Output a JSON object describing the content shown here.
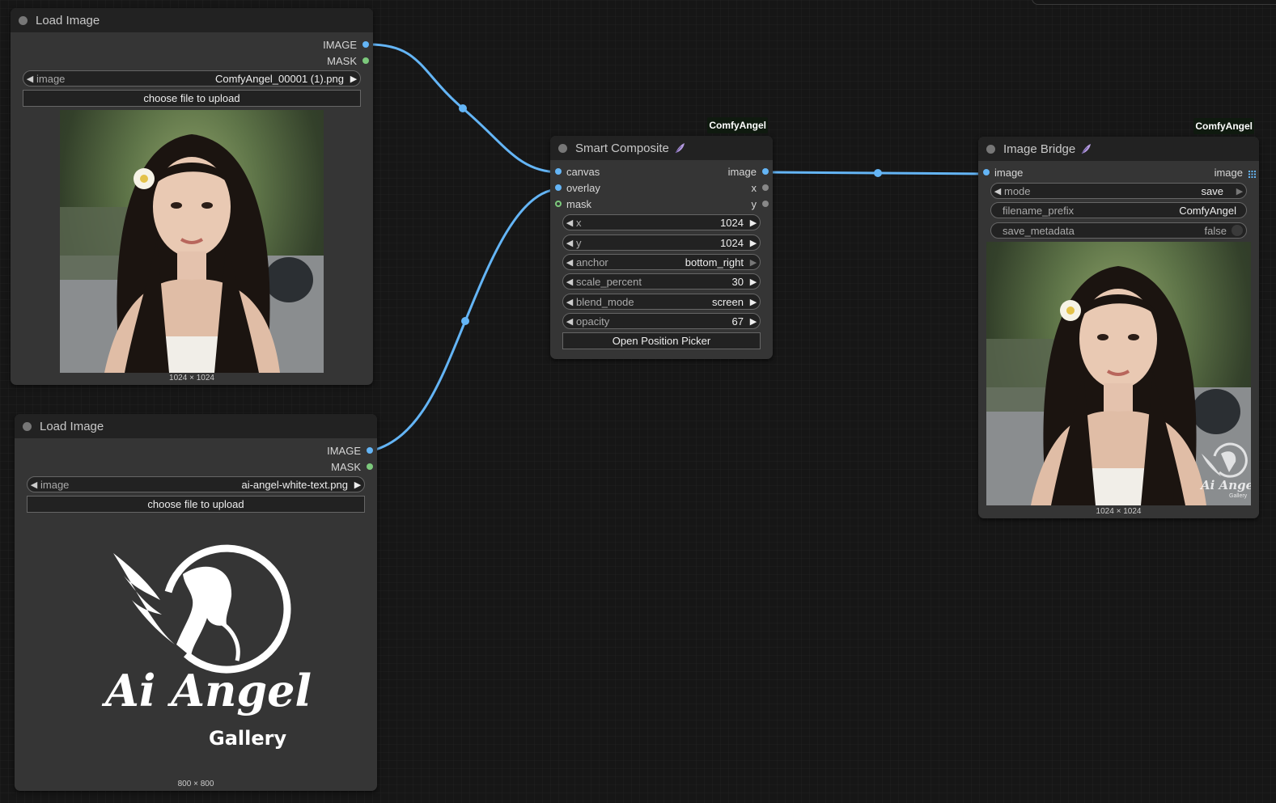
{
  "load_image_1": {
    "title": "Load Image",
    "outputs": [
      "IMAGE",
      "MASK"
    ],
    "image_widget": {
      "label": "image",
      "value": "ComfyAngel_00001 (1).png"
    },
    "upload_button": "choose file to upload",
    "preview_size": "1024 × 1024"
  },
  "load_image_2": {
    "title": "Load Image",
    "outputs": [
      "IMAGE",
      "MASK"
    ],
    "image_widget": {
      "label": "image",
      "value": "ai-angel-white-text.png"
    },
    "upload_button": "choose file to upload",
    "logo_text_main": "Ai Angel",
    "logo_text_sub": "Gallery",
    "preview_size": "800 × 800"
  },
  "smart_composite": {
    "badge": "ComfyAngel",
    "title": "Smart Composite",
    "inputs": [
      "canvas",
      "overlay",
      "mask"
    ],
    "outputs": [
      "image",
      "x",
      "y"
    ],
    "widgets": [
      {
        "label": "x",
        "value": "1024"
      },
      {
        "label": "y",
        "value": "1024"
      },
      {
        "label": "anchor",
        "value": "bottom_right"
      },
      {
        "label": "scale_percent",
        "value": "30"
      },
      {
        "label": "blend_mode",
        "value": "screen"
      },
      {
        "label": "opacity",
        "value": "67"
      }
    ],
    "button": "Open Position Picker"
  },
  "image_bridge": {
    "badge": "ComfyAngel",
    "title": "Image Bridge",
    "input": "image",
    "output": "image",
    "mode": {
      "label": "mode",
      "value": "save"
    },
    "filename_prefix": {
      "label": "filename_prefix",
      "value": "ComfyAngel"
    },
    "save_metadata": {
      "label": "save_metadata",
      "value": "false"
    },
    "preview_size": "1024 × 1024",
    "watermark_text": "Ai Angel",
    "watermark_sub": "Gallery"
  },
  "colors": {
    "link": "#64b5f6",
    "node_bg": "#353535",
    "header_bg": "#222222",
    "canvas_bg": "#161616",
    "badge_bg": "#0f1a0f"
  }
}
